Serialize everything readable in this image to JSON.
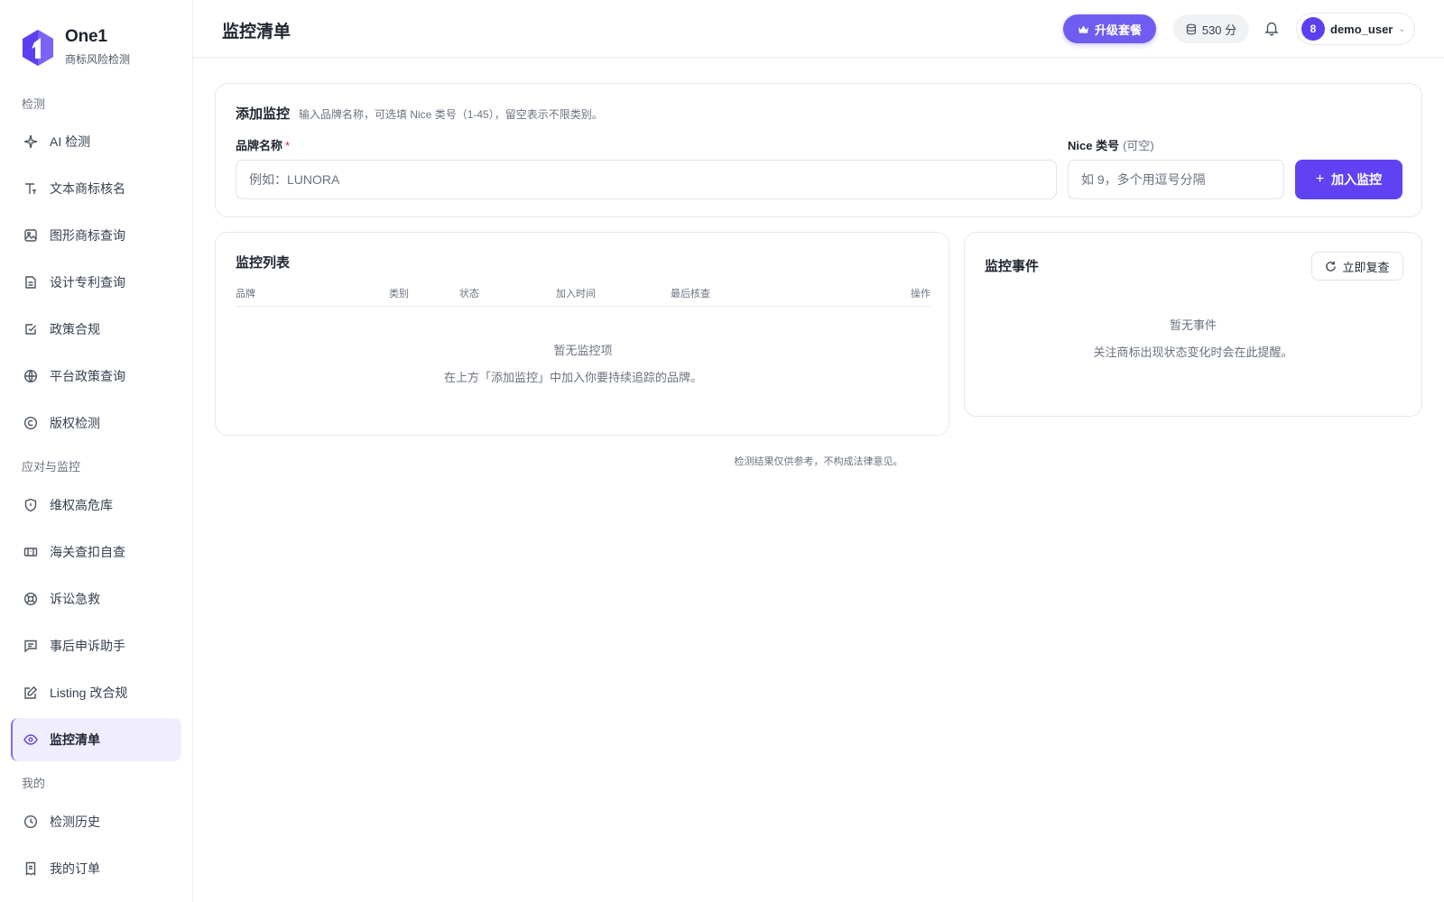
{
  "brand": {
    "name": "One1",
    "subtitle": "商标风险检测",
    "color": "#5b3ff0"
  },
  "sidebar": {
    "sections": [
      {
        "title": "检测",
        "items": [
          {
            "label": "AI 检测",
            "icon": "sparkle-icon"
          },
          {
            "label": "文本商标核名",
            "icon": "text-icon"
          },
          {
            "label": "图形商标查询",
            "icon": "image-icon"
          },
          {
            "label": "设计专利查询",
            "icon": "file-icon"
          },
          {
            "label": "政策合规",
            "icon": "checkbox-icon"
          },
          {
            "label": "平台政策查询",
            "icon": "globe-icon"
          },
          {
            "label": "版权检测",
            "icon": "copyright-icon"
          }
        ]
      },
      {
        "title": "应对与监控",
        "items": [
          {
            "label": "维权高危库",
            "icon": "shield-icon"
          },
          {
            "label": "海关查扣自查",
            "icon": "customs-icon"
          },
          {
            "label": "诉讼急救",
            "icon": "lifebuoy-icon"
          },
          {
            "label": "事后申诉助手",
            "icon": "message-icon"
          },
          {
            "label": "Listing 改合规",
            "icon": "edit-icon"
          },
          {
            "label": "监控清单",
            "icon": "eye-icon",
            "active": true
          }
        ]
      },
      {
        "title": "我的",
        "items": [
          {
            "label": "检测历史",
            "icon": "clock-icon"
          },
          {
            "label": "我的订单",
            "icon": "receipt-icon"
          }
        ]
      }
    ],
    "active_color": "#efedfe"
  },
  "header": {
    "title": "监控清单",
    "upgrade_label": "升级套餐",
    "points_label": "530 分",
    "user": {
      "avatar_text": "8",
      "name": "demo_user"
    },
    "accent": "#6f5cf0"
  },
  "add_monitor": {
    "title": "添加监控",
    "description": "输入品牌名称，可选填 Nice 类号（1-45），留空表示不限类别。",
    "brand_label": "品牌名称",
    "required_mark": "*",
    "brand_placeholder": "例如：LUNORA",
    "brand_value": "",
    "nice_label": "Nice 类号",
    "nice_optional": "(可空)",
    "nice_placeholder": "如 9，多个用逗号分隔",
    "nice_value": "",
    "submit_label": "加入监控",
    "submit_icon": "plus-icon",
    "button_color": "#6142f2"
  },
  "monitor_list": {
    "title": "监控列表",
    "columns": [
      "品牌",
      "类别",
      "状态",
      "加入时间",
      "最后核查",
      "操作"
    ],
    "rows": [],
    "empty_title": "暂无监控项",
    "empty_hint": "在上方「添加监控」中加入你要持续追踪的品牌。"
  },
  "events": {
    "title": "监控事件",
    "recheck_label": "立即复查",
    "empty_title": "暂无事件",
    "empty_hint": "关注商标出现状态变化时会在此提醒。"
  },
  "footer": {
    "disclaimer": "检测结果仅供参考，不构成法律意见。"
  }
}
